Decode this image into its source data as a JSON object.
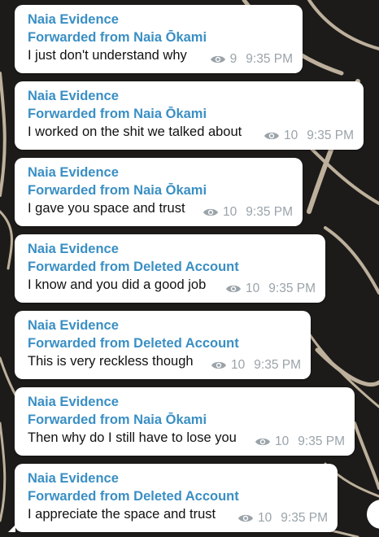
{
  "messages": [
    {
      "sender": "Naia Evidence",
      "forwarded": "Forwarded from Naia Ōkami",
      "text": "I just don't understand why",
      "views": "9",
      "time": "9:35 PM"
    },
    {
      "sender": "Naia Evidence",
      "forwarded": "Forwarded from Naia Ōkami",
      "text": "I worked on the shit we talked about",
      "views": "10",
      "time": "9:35 PM"
    },
    {
      "sender": "Naia Evidence",
      "forwarded": "Forwarded from Naia Ōkami",
      "text": "I gave you space and trust",
      "views": "10",
      "time": "9:35 PM"
    },
    {
      "sender": "Naia Evidence",
      "forwarded": "Forwarded from Deleted Account",
      "text": "I know and you did a good job",
      "views": "10",
      "time": "9:35 PM"
    },
    {
      "sender": "Naia Evidence",
      "forwarded": "Forwarded from Deleted Account",
      "text": "This is very reckless though",
      "views": "10",
      "time": "9:35 PM"
    },
    {
      "sender": "Naia Evidence",
      "forwarded": "Forwarded from Naia Ōkami",
      "text": "Then why do I still have to lose you",
      "views": "10",
      "time": "9:35 PM"
    },
    {
      "sender": "Naia Evidence",
      "forwarded": "Forwarded from Deleted Account",
      "text": "I appreciate the space and trust",
      "views": "10",
      "time": "9:35 PM"
    }
  ],
  "icons": {
    "views": "eye-icon"
  },
  "colors": {
    "sender_name": "#3a8fc4",
    "meta": "#9aa3a9",
    "bubble": "#ffffff",
    "wallpaper": "#1d1b19"
  }
}
